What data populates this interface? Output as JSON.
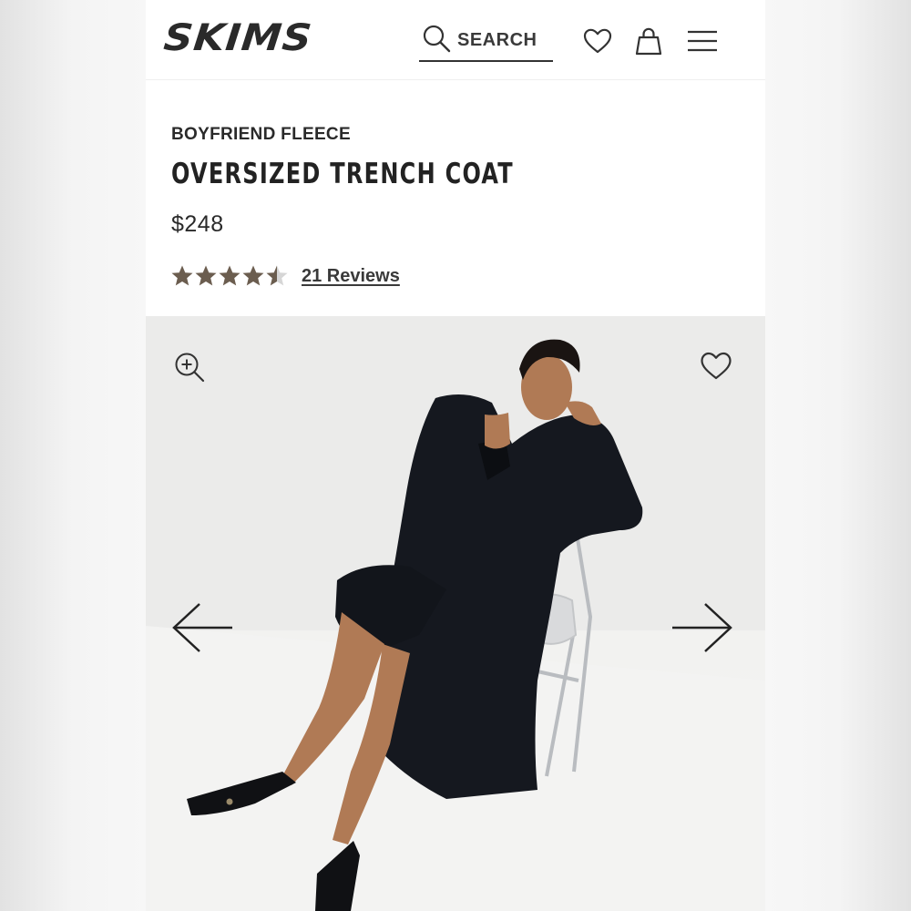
{
  "header": {
    "logo": "SKIMS",
    "search_label": "SEARCH"
  },
  "icons": {
    "search": "search-icon",
    "wishlist": "heart-icon",
    "bag": "shopping-bag-icon",
    "menu": "hamburger-menu-icon",
    "zoom": "zoom-in-icon",
    "favorite": "heart-outline-icon",
    "prev": "arrow-left-icon",
    "next": "arrow-right-icon"
  },
  "product": {
    "collection": "BOYFRIEND FLEECE",
    "title": "OVERSIZED TRENCH COAT",
    "price": "$248",
    "rating": 4.5,
    "rating_max": 5,
    "reviews_label": "21 Reviews"
  },
  "colors": {
    "text": "#1e1e1e",
    "star_fill": "#6b5d4f",
    "background": "#ffffff"
  }
}
